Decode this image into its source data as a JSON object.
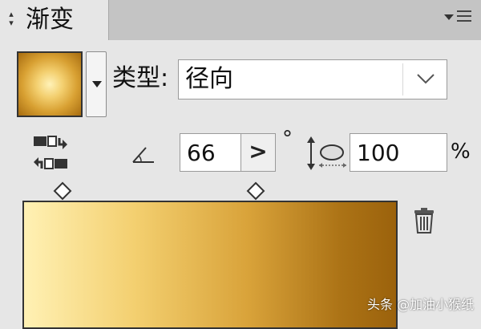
{
  "panel": {
    "tab_title": "渐变",
    "colors": {
      "panel_bg": "#e6e6e6",
      "tabbar_bg": "#c4c4c4"
    }
  },
  "gradient": {
    "type_label": "类型:",
    "type_value": "径向",
    "angle_value": "66",
    "angle_button": ">",
    "angle_unit": "°",
    "aspect_value": "100",
    "aspect_unit": "%",
    "stop_colors": [
      "#fff1b4",
      "#f3cf6f",
      "#d9a33a",
      "#ac7316",
      "#9b620c"
    ]
  },
  "icons": {
    "panel_toggle": "up-down-arrows-icon",
    "panel_menu": "panel-menu-icon",
    "reverse": "reverse-gradient-icon",
    "angle": "angle-icon",
    "aspect": "aspect-ratio-icon",
    "delete": "trash-icon"
  },
  "watermark": "头条 @加油小猴纸"
}
